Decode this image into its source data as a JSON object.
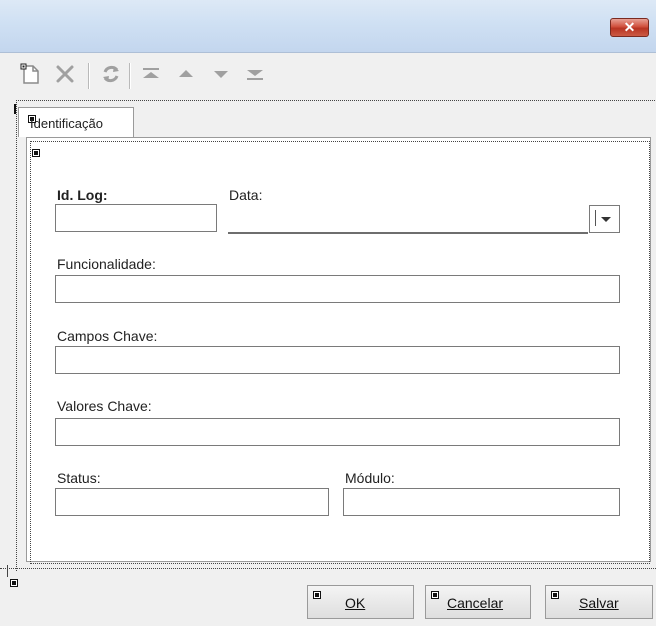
{
  "window": {
    "close_glyph": "✕"
  },
  "toolbar": {
    "icons": [
      "new-document-icon",
      "delete-icon",
      "refresh-icon",
      "first-record-icon",
      "previous-record-icon",
      "next-record-icon",
      "last-record-icon"
    ]
  },
  "tabs": [
    {
      "label": "Identificação"
    }
  ],
  "form": {
    "id_log_label": "Id. Log:",
    "id_log_value": "",
    "data_label": "Data:",
    "data_value": "",
    "funcionalidade_label": "Funcionalidade:",
    "funcionalidade_value": "",
    "campos_chave_label": "Campos Chave:",
    "campos_chave_value": "",
    "valores_chave_label": "Valores Chave:",
    "valores_chave_value": "",
    "status_label": "Status:",
    "status_value": "",
    "modulo_label": "Módulo:",
    "modulo_value": ""
  },
  "buttons": {
    "ok": "OK",
    "cancelar": "Cancelar",
    "salvar": "Salvar"
  },
  "colors": {
    "close_button": "#c9432f",
    "titlebar": "#cfe0f3",
    "toolbar_icon": "#a9a9a9"
  }
}
